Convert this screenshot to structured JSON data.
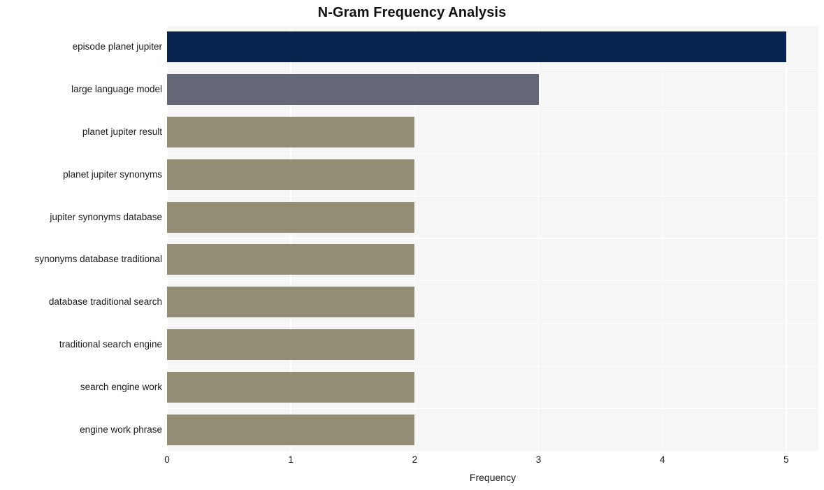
{
  "chart_data": {
    "type": "bar",
    "orientation": "horizontal",
    "title": "N-Gram Frequency Analysis",
    "xlabel": "Frequency",
    "ylabel": "",
    "categories": [
      "episode planet jupiter",
      "large language model",
      "planet jupiter result",
      "planet jupiter synonyms",
      "jupiter synonyms database",
      "synonyms database traditional",
      "database traditional search",
      "traditional search engine",
      "search engine work",
      "engine work phrase"
    ],
    "values": [
      5,
      3,
      2,
      2,
      2,
      2,
      2,
      2,
      2,
      2
    ],
    "bar_colors": [
      "#0a2450",
      "#646876",
      "#948d76",
      "#948d76",
      "#948d76",
      "#948d76",
      "#948d76",
      "#948d76",
      "#948d76",
      "#948d76"
    ],
    "xlim": [
      0,
      5.26
    ],
    "xticks": [
      0,
      1,
      2,
      3,
      4,
      5
    ],
    "xtick_labels": [
      "0",
      "1",
      "2",
      "3",
      "4",
      "5"
    ],
    "grid": true,
    "grid_color": "#ffffff",
    "plot_background": "#f6f6f7",
    "figure_background": "#ffffff",
    "legend": null
  }
}
